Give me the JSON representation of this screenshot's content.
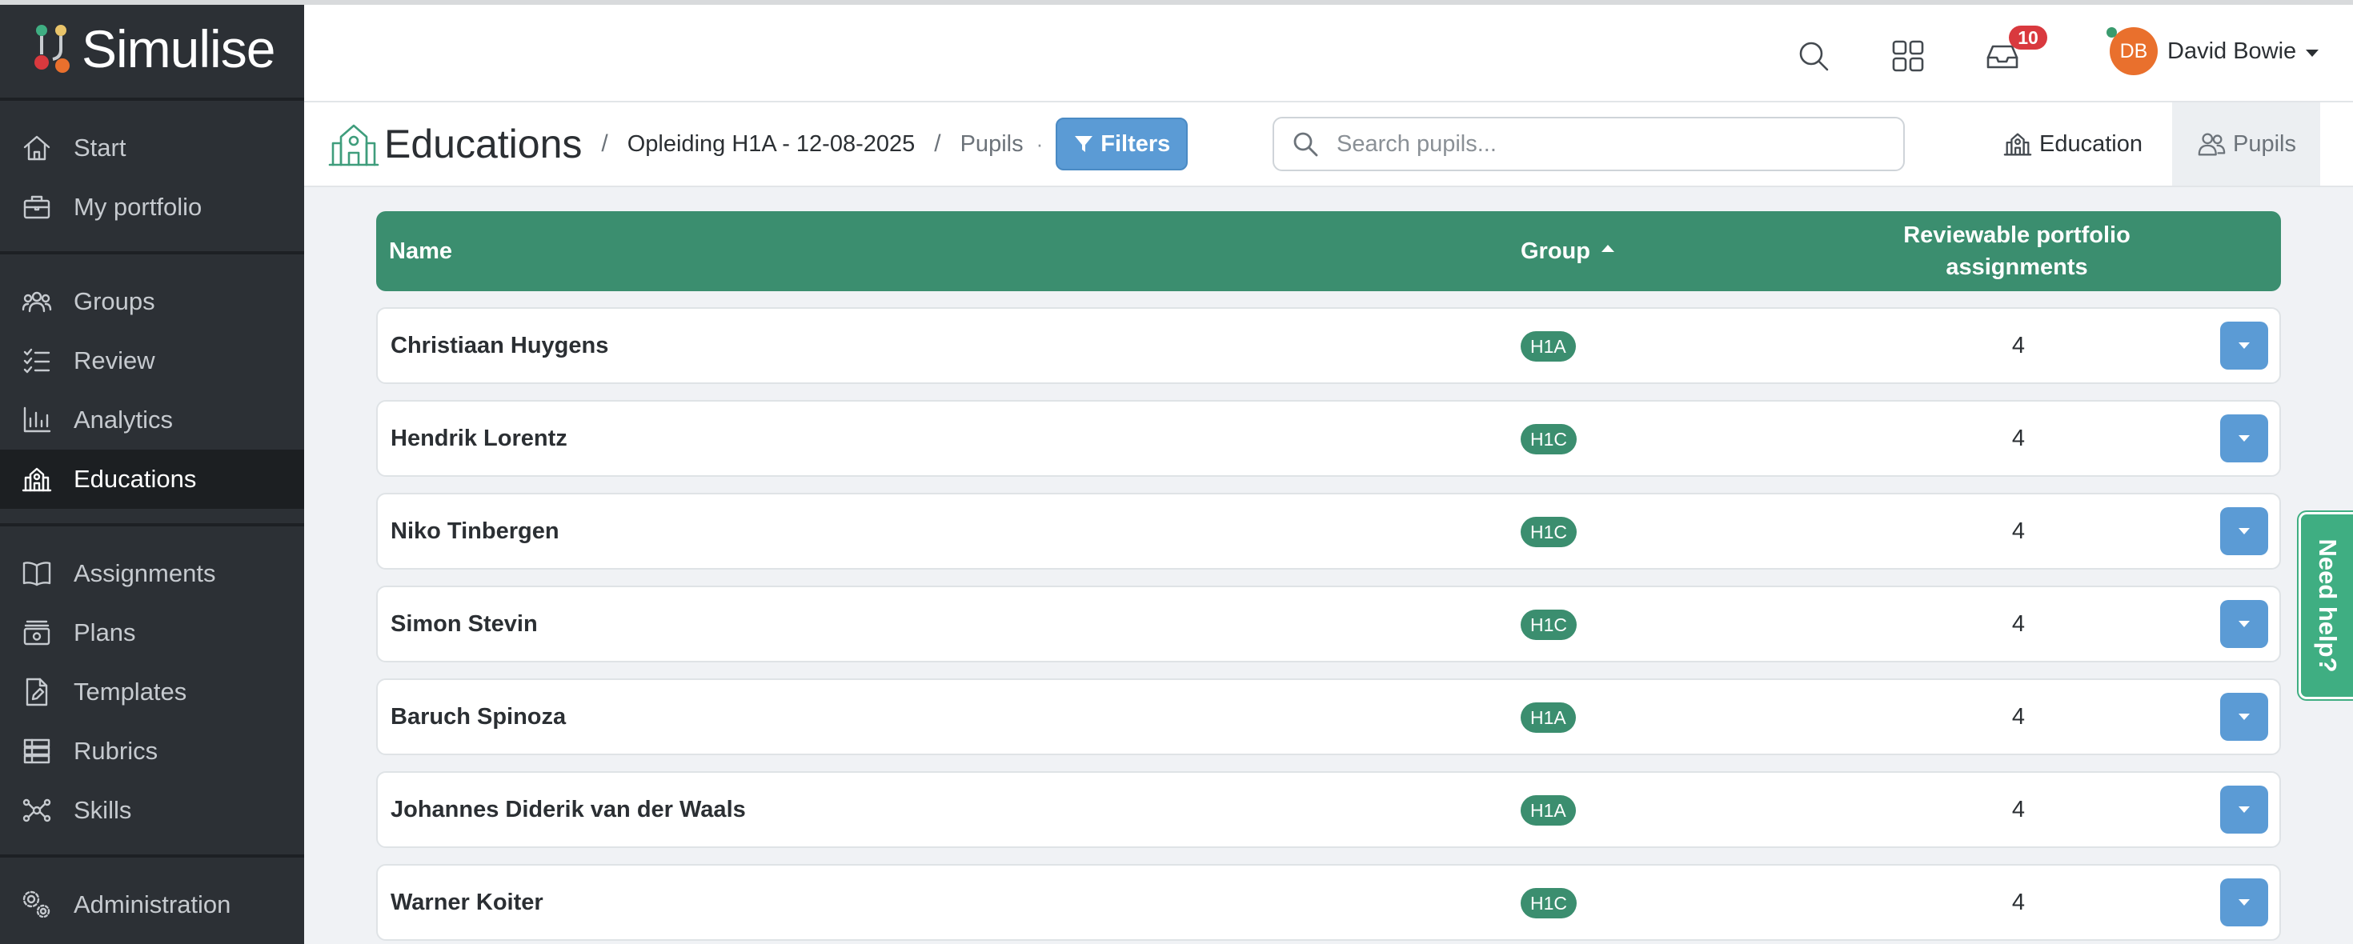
{
  "app": {
    "name": "Simulise"
  },
  "sidebar": {
    "groups": [
      [
        {
          "label": "Start",
          "icon": "home-icon"
        },
        {
          "label": "My portfolio",
          "icon": "briefcase-icon"
        }
      ],
      [
        {
          "label": "Groups",
          "icon": "users-icon"
        },
        {
          "label": "Review",
          "icon": "checklist-icon"
        },
        {
          "label": "Analytics",
          "icon": "bar-chart-icon"
        },
        {
          "label": "Educations",
          "icon": "school-icon",
          "active": true
        }
      ],
      [
        {
          "label": "Assignments",
          "icon": "book-icon"
        },
        {
          "label": "Plans",
          "icon": "plans-icon"
        },
        {
          "label": "Templates",
          "icon": "file-pen-icon"
        },
        {
          "label": "Rubrics",
          "icon": "rubric-icon"
        },
        {
          "label": "Skills",
          "icon": "skills-icon"
        }
      ],
      [
        {
          "label": "Administration",
          "icon": "gears-icon"
        }
      ]
    ]
  },
  "header": {
    "notifications_count": "10",
    "user": {
      "initials": "DB",
      "name": "David Bowie",
      "avatar_color": "#e9702d"
    }
  },
  "breadcrumb": {
    "title": "Educations",
    "education": "Opleiding H1A - 12-08-2025",
    "current": "Pupils",
    "filters_label": "Filters"
  },
  "search": {
    "placeholder": "Search pupils...",
    "value": ""
  },
  "view_tabs": {
    "education": "Education",
    "pupils": "Pupils"
  },
  "table": {
    "columns": {
      "name": "Name",
      "group": "Group",
      "reviewable": "Reviewable portfolio assignments"
    },
    "rows": [
      {
        "name": "Christiaan Huygens",
        "group": "H1A",
        "count": "4"
      },
      {
        "name": "Hendrik Lorentz",
        "group": "H1C",
        "count": "4"
      },
      {
        "name": "Niko Tinbergen",
        "group": "H1C",
        "count": "4"
      },
      {
        "name": "Simon Stevin",
        "group": "H1C",
        "count": "4"
      },
      {
        "name": "Baruch Spinoza",
        "group": "H1A",
        "count": "4"
      },
      {
        "name": "Johannes Diderik van der Waals",
        "group": "H1A",
        "count": "4"
      },
      {
        "name": "Warner Koiter",
        "group": "H1C",
        "count": "4"
      }
    ]
  },
  "help": {
    "label": "Need help?"
  },
  "colors": {
    "primary_green": "#3b8e6f",
    "button_blue": "#5b9bd5",
    "sidebar_bg": "#2c3035",
    "badge_red": "#d9393e"
  }
}
